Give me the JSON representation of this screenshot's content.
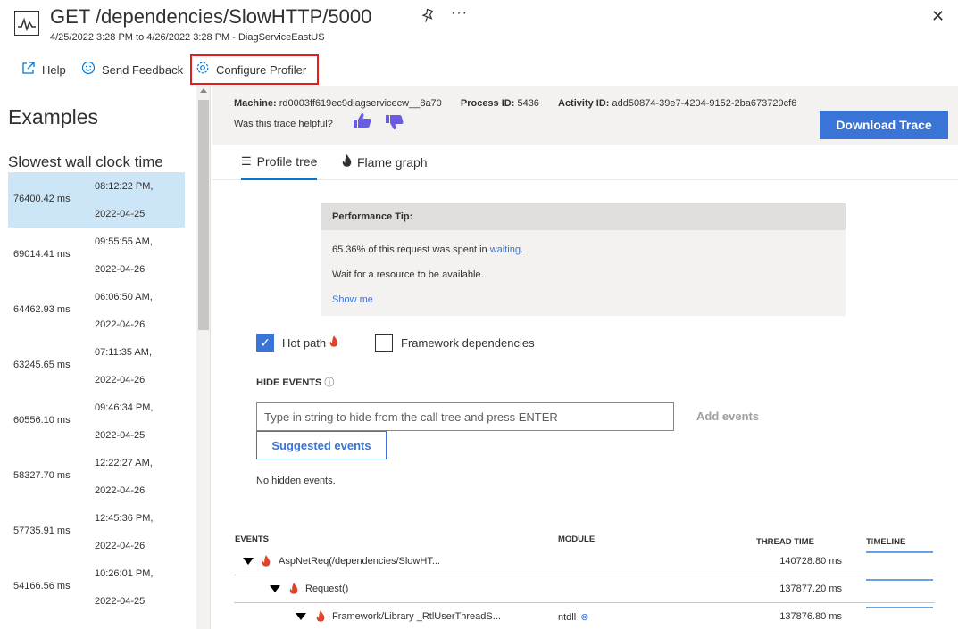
{
  "header": {
    "title": "GET /dependencies/SlowHTTP/5000",
    "subtitle": "4/25/2022 3:28 PM to 4/26/2022 3:28 PM - DiagServiceEastUS"
  },
  "toolbar": {
    "help_label": "Help",
    "feedback_label": "Send Feedback",
    "configure_label": "Configure Profiler"
  },
  "sidebar": {
    "title": "Examples",
    "subtitle": "Slowest wall clock time",
    "items": [
      {
        "ms": "76400.42 ms",
        "time": "08:12:22 PM,",
        "date": "2022-04-25"
      },
      {
        "ms": "69014.41 ms",
        "time": "09:55:55 AM,",
        "date": "2022-04-26"
      },
      {
        "ms": "64462.93 ms",
        "time": "06:06:50 AM,",
        "date": "2022-04-26"
      },
      {
        "ms": "63245.65 ms",
        "time": "07:11:35 AM,",
        "date": "2022-04-26"
      },
      {
        "ms": "60556.10 ms",
        "time": "09:46:34 PM,",
        "date": "2022-04-25"
      },
      {
        "ms": "58327.70 ms",
        "time": "12:22:27 AM,",
        "date": "2022-04-26"
      },
      {
        "ms": "57735.91 ms",
        "time": "12:45:36 PM,",
        "date": "2022-04-26"
      },
      {
        "ms": "54166.56 ms",
        "time": "10:26:01 PM,",
        "date": "2022-04-25"
      }
    ]
  },
  "info": {
    "machine_label": "Machine:",
    "machine_value": "rd0003ff619ec9diagservicecw__8a70",
    "process_label": "Process ID:",
    "process_value": "5436",
    "activity_label": "Activity ID:",
    "activity_value": "add50874-39e7-4204-9152-2ba673729cf6",
    "helpful": "Was this trace helpful?",
    "download_label": "Download Trace"
  },
  "tabs": {
    "profile_tree": "Profile tree",
    "flame_graph": "Flame graph"
  },
  "perf_tip": {
    "heading": "Performance Tip:",
    "line1_prefix": "65.36% of this request was spent in ",
    "line1_link": "waiting.",
    "line2": "Wait for a resource to be available.",
    "show_me": "Show me"
  },
  "options": {
    "hot_path": "Hot path",
    "hot_path_checked": true,
    "framework_deps": "Framework dependencies",
    "framework_deps_checked": false
  },
  "hide_events": {
    "heading": "HIDE EVENTS",
    "placeholder": "Type in string to hide from the call tree and press ENTER",
    "add_label": "Add events",
    "suggested_label": "Suggested events",
    "none_label": "No hidden events."
  },
  "events_table": {
    "col_events": "EVENTS",
    "col_module": "MODULE",
    "col_thread": "THREAD TIME",
    "col_timeline": "TIMELINE",
    "rows": [
      {
        "name": "AspNetReq(/dependencies/SlowHT...",
        "module": "",
        "thread_time": "140728.80 ms",
        "depth": 0
      },
      {
        "name": "Request()",
        "module": "",
        "thread_time": "137877.20 ms",
        "depth": 1
      },
      {
        "name": "Framework/Library _RtlUserThreadS...",
        "module": "ntdll",
        "thread_time": "137876.80 ms",
        "depth": 2
      }
    ]
  },
  "colors": {
    "accent": "#3a74d6",
    "highlight_border": "#e02020",
    "selected_row": "#cde6f7",
    "flame": "#e0422a",
    "thumbs": "#6a5ce0"
  }
}
